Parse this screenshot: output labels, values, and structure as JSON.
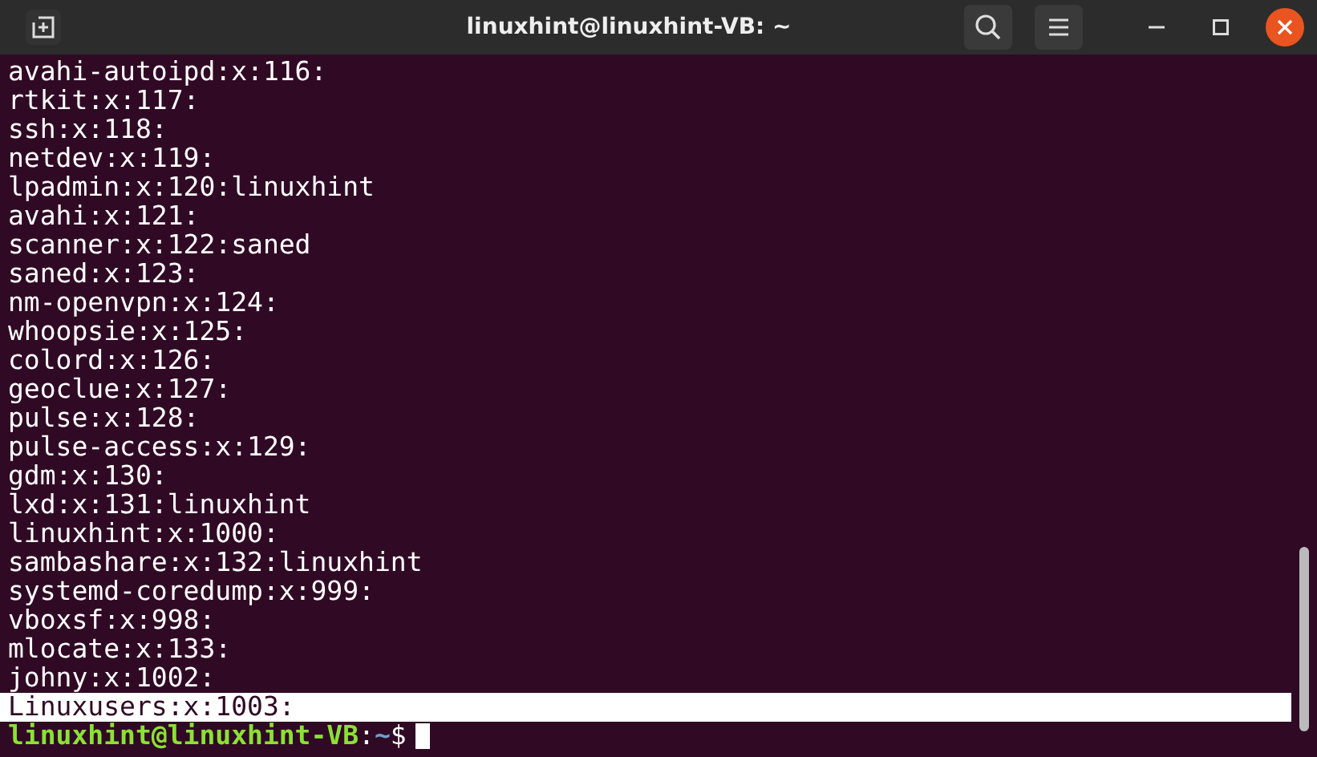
{
  "window": {
    "title": "linuxhint@linuxhint-VB: ~"
  },
  "lines": [
    {
      "text": "avahi-autoipd:x:116:",
      "highlighted": false
    },
    {
      "text": "rtkit:x:117:",
      "highlighted": false
    },
    {
      "text": "ssh:x:118:",
      "highlighted": false
    },
    {
      "text": "netdev:x:119:",
      "highlighted": false
    },
    {
      "text": "lpadmin:x:120:linuxhint",
      "highlighted": false
    },
    {
      "text": "avahi:x:121:",
      "highlighted": false
    },
    {
      "text": "scanner:x:122:saned",
      "highlighted": false
    },
    {
      "text": "saned:x:123:",
      "highlighted": false
    },
    {
      "text": "nm-openvpn:x:124:",
      "highlighted": false
    },
    {
      "text": "whoopsie:x:125:",
      "highlighted": false
    },
    {
      "text": "colord:x:126:",
      "highlighted": false
    },
    {
      "text": "geoclue:x:127:",
      "highlighted": false
    },
    {
      "text": "pulse:x:128:",
      "highlighted": false
    },
    {
      "text": "pulse-access:x:129:",
      "highlighted": false
    },
    {
      "text": "gdm:x:130:",
      "highlighted": false
    },
    {
      "text": "lxd:x:131:linuxhint",
      "highlighted": false
    },
    {
      "text": "linuxhint:x:1000:",
      "highlighted": false
    },
    {
      "text": "sambashare:x:132:linuxhint",
      "highlighted": false
    },
    {
      "text": "systemd-coredump:x:999:",
      "highlighted": false
    },
    {
      "text": "vboxsf:x:998:",
      "highlighted": false
    },
    {
      "text": "mlocate:x:133:",
      "highlighted": false
    },
    {
      "text": "johny:x:1002:",
      "highlighted": false
    },
    {
      "text": "Linuxusers:x:1003:",
      "highlighted": true
    }
  ],
  "prompt": {
    "user_host": "linuxhint@linuxhint-VB",
    "separator": ":",
    "path": "~",
    "symbol": "$"
  }
}
